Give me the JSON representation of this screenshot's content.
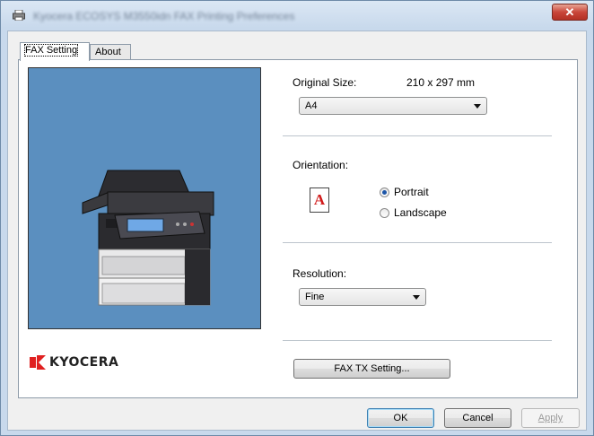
{
  "window": {
    "title": "Kyocera ECOSYS M3550idn FAX Printing Preferences",
    "close_label": "✕"
  },
  "tabs": [
    {
      "label": "FAX Setting",
      "active": true
    },
    {
      "label": "About",
      "active": false
    }
  ],
  "logo": {
    "text": "KYOCERA",
    "brand_color": "#e02020"
  },
  "original_size": {
    "label": "Original Size:",
    "dimensions": "210 x 297 mm",
    "selected": "A4"
  },
  "orientation": {
    "label": "Orientation:",
    "icon_letter": "A",
    "options": [
      {
        "label": "Portrait",
        "checked": true
      },
      {
        "label": "Landscape",
        "checked": false
      }
    ]
  },
  "resolution": {
    "label": "Resolution:",
    "selected": "Fine"
  },
  "fax_tx_button": "FAX TX Setting...",
  "dialog_buttons": {
    "ok": "OK",
    "cancel": "Cancel",
    "apply": "Apply"
  },
  "colors": {
    "preview_bg": "#5b8fbf",
    "close_button": "#c9463a",
    "radio_dot": "#1d56a8"
  }
}
